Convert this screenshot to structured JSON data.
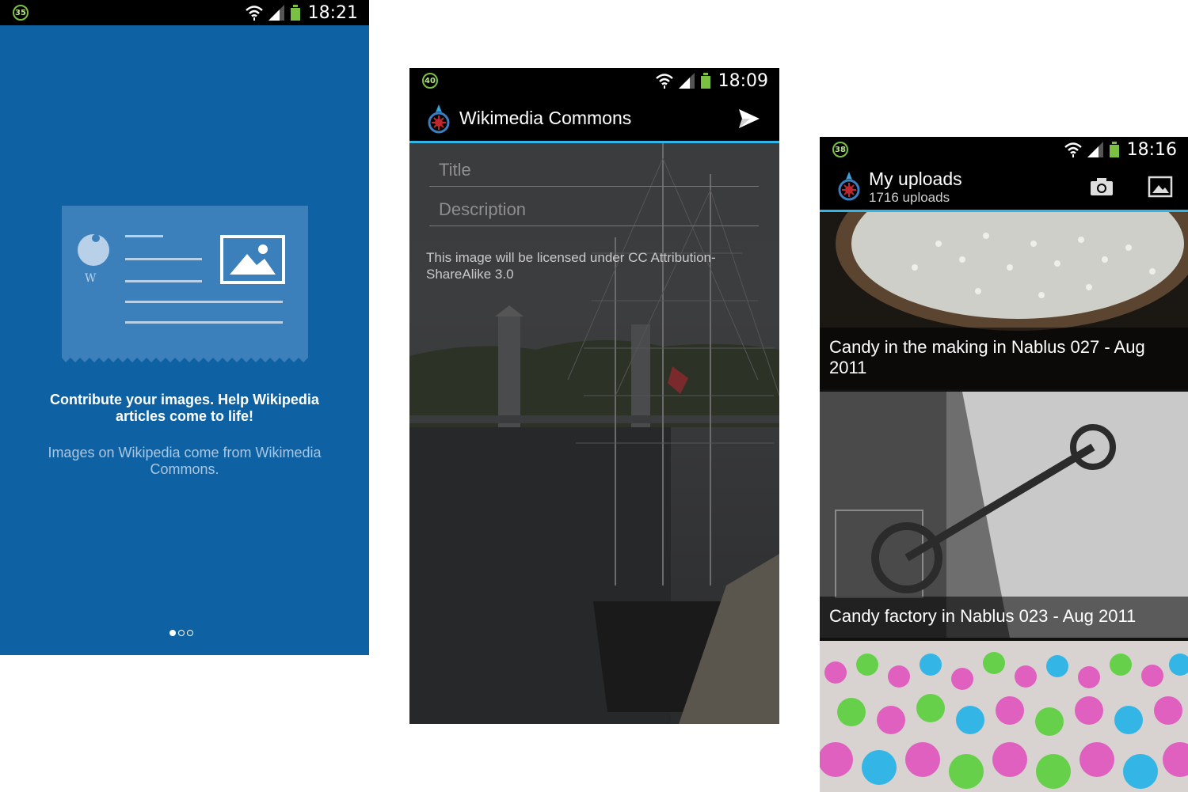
{
  "phone1": {
    "status": {
      "badge": "35",
      "time": "18:21"
    },
    "headline": "Contribute your images. Help Wikipedia articles come to life!",
    "subtext": "Images on Wikipedia come from Wikimedia Commons.",
    "card_logo_letter": "W",
    "pager": {
      "pages": 3,
      "current": 1
    }
  },
  "phone2": {
    "status": {
      "badge": "40",
      "time": "18:09"
    },
    "app_title": "Wikimedia Commons",
    "title_placeholder": "Title",
    "description_placeholder": "Description",
    "license_text": "This image will be licensed under CC Attribution-ShareAlike 3.0"
  },
  "phone3": {
    "status": {
      "badge": "38",
      "time": "18:16"
    },
    "title": "My uploads",
    "subtitle": "1716 uploads",
    "uploads": [
      {
        "caption": "Candy in the making in Nablus 027 - Aug 2011"
      },
      {
        "caption": "Candy factory in Nablus 023 - Aug 2011"
      },
      {
        "caption": ""
      }
    ]
  },
  "colors": {
    "onboarding_bg": "#0e62a3",
    "accent_line": "#33b5e5",
    "battery_green": "#7ac143"
  },
  "icons": [
    "wifi-icon",
    "signal-icon",
    "battery-icon",
    "commons-logo-icon",
    "send-icon",
    "camera-icon",
    "gallery-icon"
  ]
}
